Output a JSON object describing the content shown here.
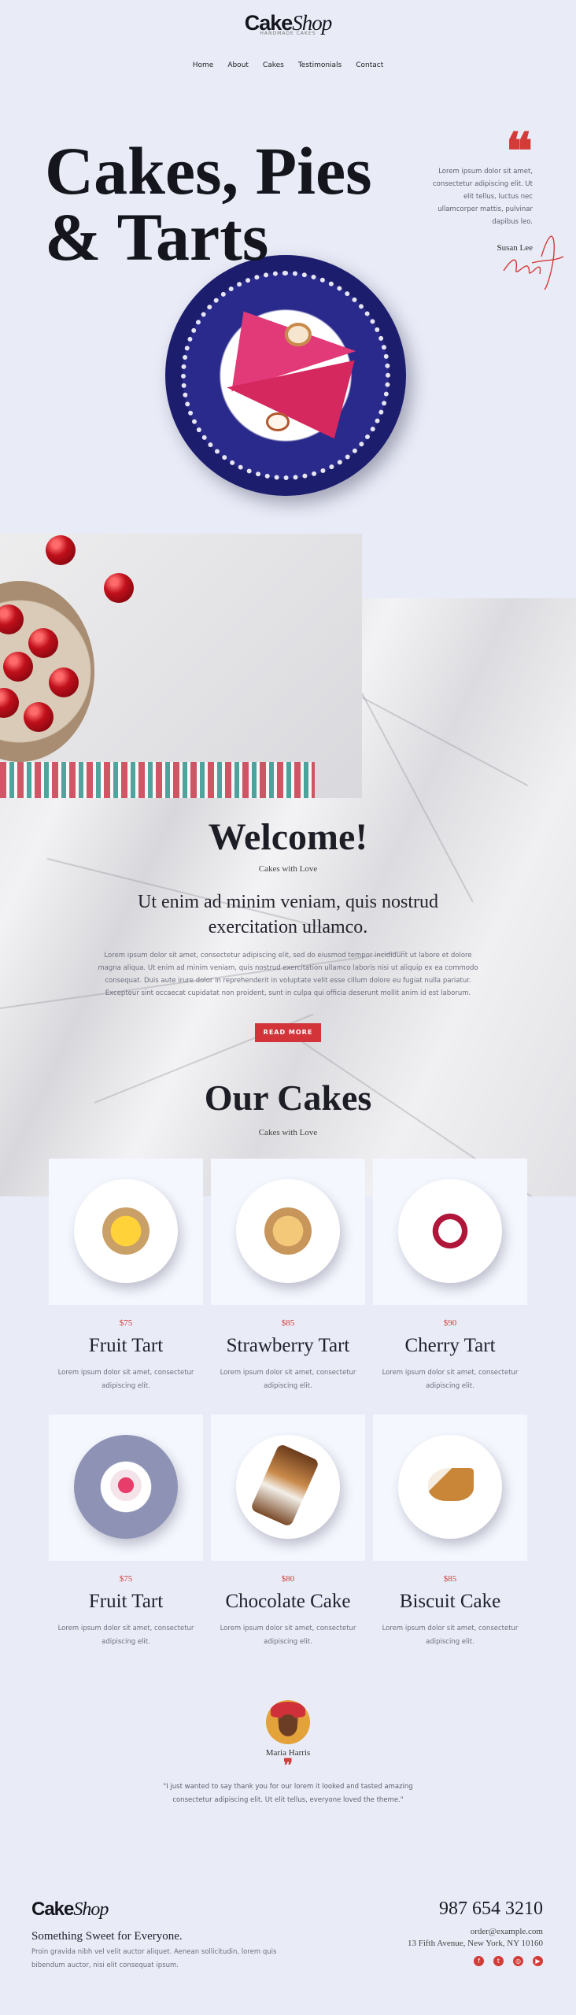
{
  "brand": {
    "logo_main": "Cake",
    "logo_italic": "Shop",
    "logo_sub": "HANDMADE CAKES"
  },
  "nav": [
    "Home",
    "About",
    "Cakes",
    "Testimonials",
    "Contact"
  ],
  "hero": {
    "title_line1": "Cakes, Pies",
    "title_line2": "& Tarts",
    "quote_mark": "❝",
    "quote_text": "Lorem ipsum dolor sit amet, consectetur adipiscing elit. Ut elit tellus, luctus nec ullamcorper mattis, pulvinar dapibus leo.",
    "quote_author": "Susan Lee"
  },
  "welcome": {
    "title": "Welcome!",
    "subtitle": "Cakes with Love",
    "lead": "Ut enim ad minim veniam, quis nostrud exercitation ullamco.",
    "paragraph": "Lorem ipsum dolor sit amet, consectetur adipiscing elit, sed do eiusmod tempor incididunt ut labore et dolore magna aliqua. Ut enim ad minim veniam, quis nostrud exercitation ullamco laboris nisi ut aliquip ex ea commodo consequat. Duis aute irure dolor in reprehenderit in voluptate velit esse cillum dolore eu fugiat nulla pariatur. Excepteur sint occaecat cupidatat non proident, sunt in culpa qui officia deserunt mollit anim id est laborum.",
    "button": "READ MORE"
  },
  "cakes_section": {
    "title": "Our Cakes",
    "subtitle": "Cakes with Love"
  },
  "cakes": [
    {
      "price": "$75",
      "name": "Fruit Tart",
      "desc": "Lorem ipsum dolor sit amet, consectetur adipiscing elit."
    },
    {
      "price": "$85",
      "name": "Strawberry Tart",
      "desc": "Lorem ipsum dolor sit amet, consectetur adipiscing elit."
    },
    {
      "price": "$90",
      "name": "Cherry Tart",
      "desc": "Lorem ipsum dolor sit amet, consectetur adipiscing elit."
    },
    {
      "price": "$75",
      "name": "Fruit Tart",
      "desc": "Lorem ipsum dolor sit amet, consectetur adipiscing elit."
    },
    {
      "price": "$80",
      "name": "Chocolate Cake",
      "desc": "Lorem ipsum dolor sit amet, consectetur adipiscing elit."
    },
    {
      "price": "$85",
      "name": "Biscuit Cake",
      "desc": "Lorem ipsum dolor sit amet, consectetur adipiscing elit."
    }
  ],
  "testimonial": {
    "name": "Maria Harris",
    "quote_mark": "❞",
    "text": "\"I just wanted to say thank you for our lorem it looked and tasted amazing consectetur adipiscing elit. Ut elit tellus, everyone loved the theme.\""
  },
  "footer": {
    "tagline": "Something Sweet for Everyone.",
    "text": "Proin gravida nibh vel velit auctor aliquet. Aenean sollicitudin, lorem quis bibendum auctor, nisi elit consequat ipsum.",
    "phone": "987 654 3210",
    "email": "order@example.com",
    "address": "13 Fifth Avenue, New York, NY 10160",
    "socials": [
      {
        "name": "facebook-icon",
        "glyph": "f"
      },
      {
        "name": "twitter-icon",
        "glyph": "t"
      },
      {
        "name": "instagram-icon",
        "glyph": "◎"
      },
      {
        "name": "youtube-icon",
        "glyph": "▶"
      }
    ]
  },
  "colors": {
    "accent": "#d33b38",
    "background": "#e9ecf7",
    "card": "#f5f7fe"
  }
}
